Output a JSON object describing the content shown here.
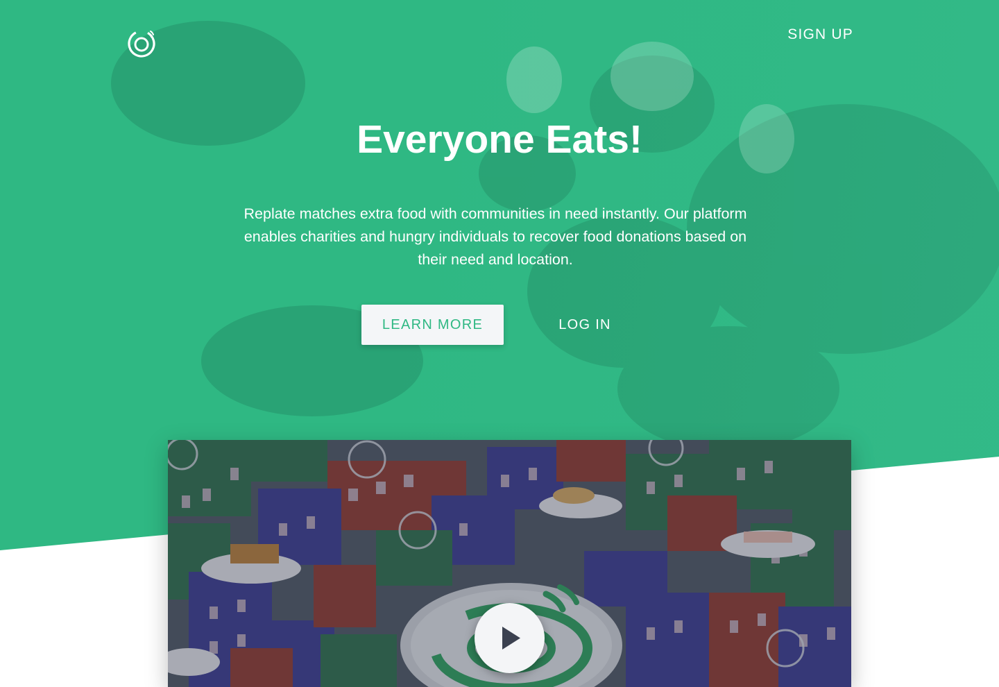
{
  "header": {
    "logo_icon": "replate-logo-icon",
    "signup_label": "SIGN UP"
  },
  "hero": {
    "title": "Everyone Eats!",
    "description": "Replate matches extra food with communities in need instantly. Our platform enables charities and hungry individuals to recover food donations based on their need and location.",
    "learn_more_label": "LEARN MORE",
    "login_label": "LOG IN"
  },
  "video": {
    "play_icon": "play-icon"
  },
  "colors": {
    "brand_green": "#2fb883",
    "button_bg": "#f4f6f8",
    "text_light": "#ffffff"
  }
}
